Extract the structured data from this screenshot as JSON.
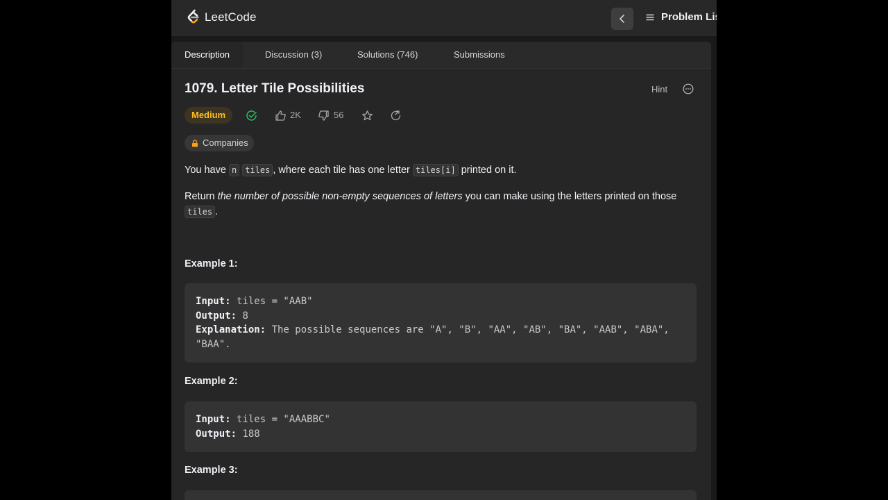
{
  "brand": {
    "name": "LeetCode"
  },
  "nav": {
    "problem_list_label": "Problem Lis"
  },
  "tabs": [
    {
      "label": "Description"
    },
    {
      "label": "Discussion (3)"
    },
    {
      "label": "Solutions (746)"
    },
    {
      "label": "Submissions"
    }
  ],
  "problem": {
    "title": "1079. Letter Tile Possibilities",
    "hint_label": "Hint",
    "difficulty": "Medium",
    "likes": "2K",
    "dislikes": "56",
    "companies_label": "Companies",
    "desc1": {
      "t1": "You have ",
      "c1": "n",
      "t2": " ",
      "c2": "tiles",
      "t3": ", where each tile has one letter ",
      "c3": "tiles[i]",
      "t4": " printed on it."
    },
    "desc2": {
      "t1": "Return ",
      "em": "the number of possible non-empty sequences of letters",
      "t2": " you can make using the letters printed on those ",
      "c1": "tiles",
      "t3": "."
    }
  },
  "examples": [
    {
      "heading": "Example 1:",
      "input_label": "Input:",
      "input": " tiles = \"AAB\"",
      "output_label": "Output:",
      "output": " 8",
      "explanation_label": "Explanation:",
      "explanation": " The possible sequences are \"A\", \"B\", \"AA\", \"AB\", \"BA\", \"AAB\", \"ABA\", \"BAA\"."
    },
    {
      "heading": "Example 2:",
      "input_label": "Input:",
      "input": " tiles = \"AAABBC\"",
      "output_label": "Output:",
      "output": " 188"
    },
    {
      "heading": "Example 3:"
    }
  ],
  "colors": {
    "difficulty_medium": "#ffc01e",
    "accepted": "#2cbb5d",
    "background": "#262626"
  },
  "icons": [
    "leetcode-logo",
    "chevron-left-icon",
    "menu-icon",
    "more-icon",
    "check-circle-icon",
    "thumbs-up-icon",
    "thumbs-down-icon",
    "star-icon",
    "share-icon",
    "lock-icon"
  ]
}
